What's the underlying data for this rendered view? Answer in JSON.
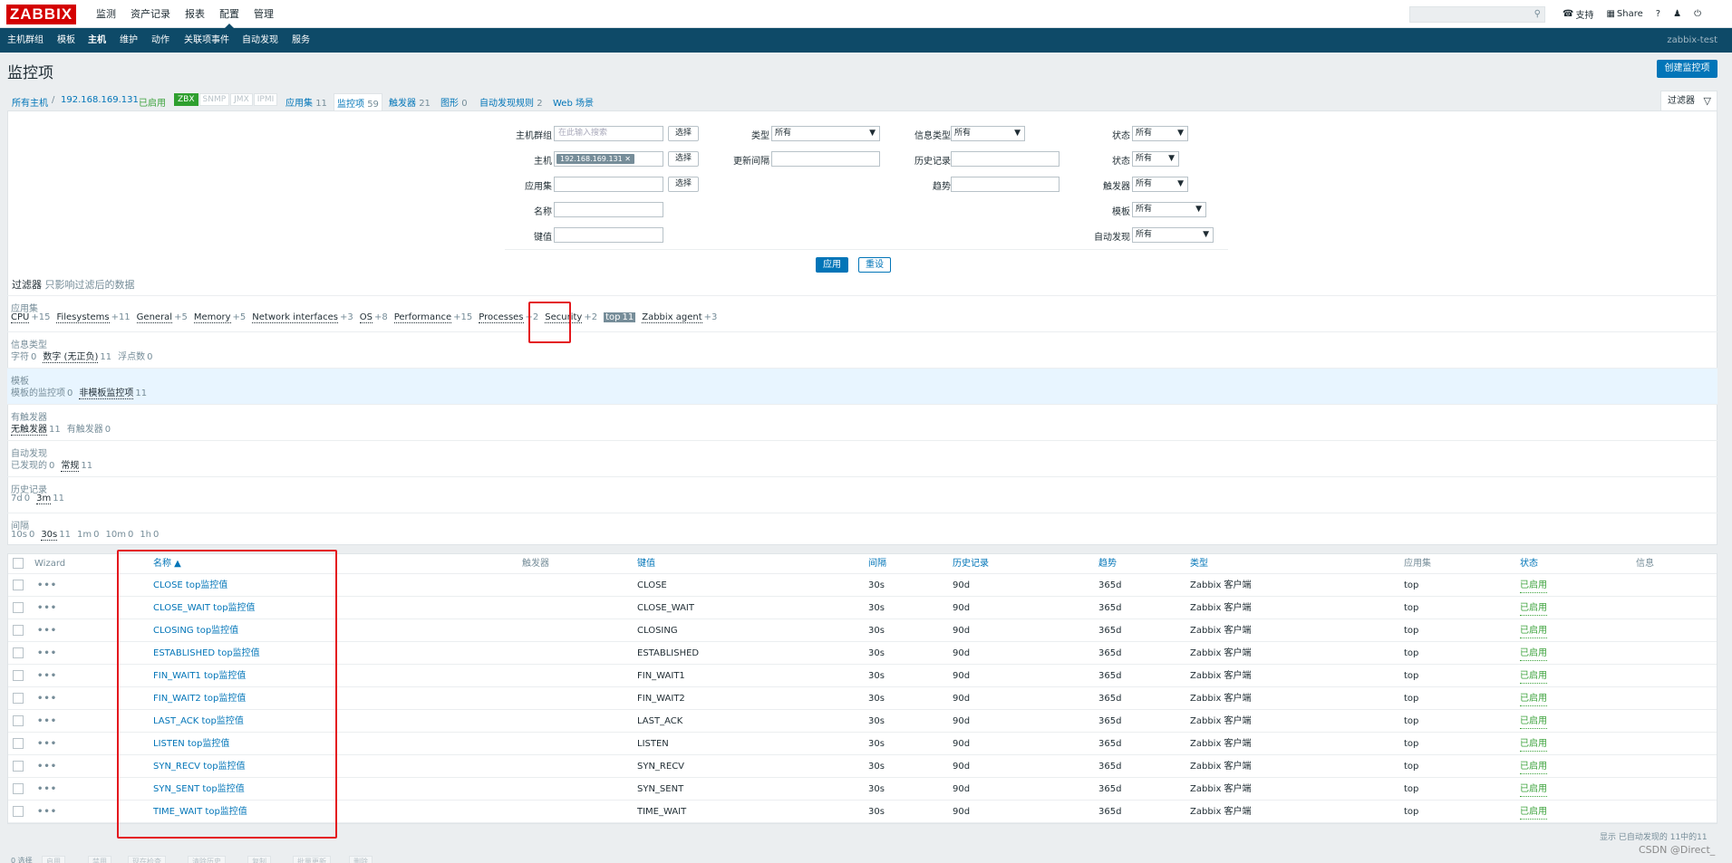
{
  "app": {
    "logo": "ZABBIX",
    "main_menu": [
      "监测",
      "资产记录",
      "报表",
      "配置",
      "管理"
    ],
    "main_menu_active": "配置",
    "top_right": {
      "support": "支持",
      "share": "Share",
      "help": "?",
      "user": "user-icon",
      "logout": "power-icon"
    },
    "search_placeholder": "",
    "sub_menu": [
      "主机群组",
      "模板",
      "主机",
      "维护",
      "动作",
      "关联项事件",
      "自动发现",
      "服务"
    ],
    "sub_menu_active": "主机",
    "server_name": "zabbix-test"
  },
  "page": {
    "title": "监控项",
    "create_button": "创建监控项",
    "filter_tab": "过滤器"
  },
  "host_nav": {
    "all_hosts": "所有主机",
    "sep": "/",
    "host": "192.168.169.131",
    "enabled": "已启用",
    "badges": [
      "ZBX",
      "SNMP",
      "JMX",
      "IPMI"
    ],
    "app": "应用集",
    "app_count": "11",
    "items": "监控项",
    "items_count": "59",
    "triggers": "触发器",
    "triggers_count": "21",
    "graphs": "图形",
    "graphs_count": "0",
    "discovery": "自动发现规则",
    "discovery_count": "2",
    "web": "Web 场景"
  },
  "filter": {
    "host_groups_label": "主机群组",
    "host_groups_placeholder": "在此输入搜索",
    "select": "选择",
    "host_label": "主机",
    "host_chip": "192.168.169.131",
    "app_label": "应用集",
    "name_label": "名称",
    "key_label": "键值",
    "type_label": "类型",
    "type_value": "所有",
    "interval_label": "更新间隔",
    "info_type_label": "信息类型",
    "info_type_value": "所有",
    "history_label": "历史记录",
    "trends_label": "趋势",
    "state_label": "状态",
    "state_value": "所有",
    "status_label": "状态",
    "status_value": "所有",
    "triggers_label": "触发器",
    "triggers_value": "所有",
    "template_label": "模板",
    "template_value": "所有",
    "discovery_label": "自动发现",
    "discovery_value": "所有",
    "apply": "应用",
    "reset": "重设",
    "subfilter_title": "过滤器",
    "subfilter_note": "只影响过滤后的数据"
  },
  "subfilters": [
    {
      "title": "应用集",
      "values": [
        {
          "name": "CPU",
          "count": "+15"
        },
        {
          "name": "Filesystems",
          "count": "+11"
        },
        {
          "name": "General",
          "count": "+5"
        },
        {
          "name": "Memory",
          "count": "+5"
        },
        {
          "name": "Network interfaces",
          "count": "+3"
        },
        {
          "name": "OS",
          "count": "+8"
        },
        {
          "name": "Performance",
          "count": "+15"
        },
        {
          "name": "Processes",
          "count": "+2"
        },
        {
          "name": "Security",
          "count": "+2"
        },
        {
          "name": "top",
          "count": "11",
          "selected": true
        },
        {
          "name": "Zabbix agent",
          "count": "+3"
        }
      ]
    },
    {
      "title": "信息类型",
      "values": [
        {
          "name": "字符",
          "count": "0",
          "plain": true
        },
        {
          "name": "数字 (无正负)",
          "count": "11"
        },
        {
          "name": "浮点数",
          "count": "0",
          "plain": true
        }
      ]
    },
    {
      "title": "模板",
      "highlight": true,
      "values": [
        {
          "name": "模板的监控项",
          "count": "0",
          "plain": true
        },
        {
          "name": "非模板监控项",
          "count": "11"
        }
      ]
    },
    {
      "title": "有触发器",
      "values": [
        {
          "name": "无触发器",
          "count": "11"
        },
        {
          "name": "有触发器",
          "count": "0",
          "plain": true
        }
      ]
    },
    {
      "title": "自动发现",
      "values": [
        {
          "name": "已发现的",
          "count": "0",
          "plain": true
        },
        {
          "name": "常规",
          "count": "11"
        }
      ]
    },
    {
      "title": "历史记录",
      "values": [
        {
          "name": "7d",
          "count": "0",
          "plain": true
        },
        {
          "name": "3m",
          "count": "11"
        }
      ]
    },
    {
      "title": "间隔",
      "values": [
        {
          "name": "10s",
          "count": "0",
          "plain": true
        },
        {
          "name": "30s",
          "count": "11"
        },
        {
          "name": "1m",
          "count": "0",
          "plain": true
        },
        {
          "name": "10m",
          "count": "0",
          "plain": true
        },
        {
          "name": "1h",
          "count": "0",
          "plain": true
        }
      ]
    }
  ],
  "table": {
    "headers": {
      "wizard": "Wizard",
      "name": "名称 ▲",
      "triggers": "触发器",
      "key": "键值",
      "interval": "间隔",
      "history": "历史记录",
      "trends": "趋势",
      "type": "类型",
      "app": "应用集",
      "status": "状态",
      "info": "信息"
    },
    "rows": [
      {
        "name": "CLOSE top监控值",
        "key": "CLOSE",
        "interval": "30s",
        "history": "90d",
        "trends": "365d",
        "type": "Zabbix 客户端",
        "app": "top",
        "status": "已启用"
      },
      {
        "name": "CLOSE_WAIT top监控值",
        "key": "CLOSE_WAIT",
        "interval": "30s",
        "history": "90d",
        "trends": "365d",
        "type": "Zabbix 客户端",
        "app": "top",
        "status": "已启用"
      },
      {
        "name": "CLOSING top监控值",
        "key": "CLOSING",
        "interval": "30s",
        "history": "90d",
        "trends": "365d",
        "type": "Zabbix 客户端",
        "app": "top",
        "status": "已启用"
      },
      {
        "name": "ESTABLISHED top监控值",
        "key": "ESTABLISHED",
        "interval": "30s",
        "history": "90d",
        "trends": "365d",
        "type": "Zabbix 客户端",
        "app": "top",
        "status": "已启用"
      },
      {
        "name": "FIN_WAIT1 top监控值",
        "key": "FIN_WAIT1",
        "interval": "30s",
        "history": "90d",
        "trends": "365d",
        "type": "Zabbix 客户端",
        "app": "top",
        "status": "已启用"
      },
      {
        "name": "FIN_WAIT2 top监控值",
        "key": "FIN_WAIT2",
        "interval": "30s",
        "history": "90d",
        "trends": "365d",
        "type": "Zabbix 客户端",
        "app": "top",
        "status": "已启用"
      },
      {
        "name": "LAST_ACK top监控值",
        "key": "LAST_ACK",
        "interval": "30s",
        "history": "90d",
        "trends": "365d",
        "type": "Zabbix 客户端",
        "app": "top",
        "status": "已启用"
      },
      {
        "name": "LISTEN top监控值",
        "key": "LISTEN",
        "interval": "30s",
        "history": "90d",
        "trends": "365d",
        "type": "Zabbix 客户端",
        "app": "top",
        "status": "已启用"
      },
      {
        "name": "SYN_RECV top监控值",
        "key": "SYN_RECV",
        "interval": "30s",
        "history": "90d",
        "trends": "365d",
        "type": "Zabbix 客户端",
        "app": "top",
        "status": "已启用"
      },
      {
        "name": "SYN_SENT top监控值",
        "key": "SYN_SENT",
        "interval": "30s",
        "history": "90d",
        "trends": "365d",
        "type": "Zabbix 客户端",
        "app": "top",
        "status": "已启用"
      },
      {
        "name": "TIME_WAIT top监控值",
        "key": "TIME_WAIT",
        "interval": "30s",
        "history": "90d",
        "trends": "365d",
        "type": "Zabbix 客户端",
        "app": "top",
        "status": "已启用"
      }
    ],
    "footer": "显示 已自动发现的 11中的11"
  },
  "action_bar": {
    "selected": "0 选择",
    "buttons": [
      "启用",
      "禁用",
      "现在检查",
      "清除历史",
      "复制",
      "批量更新",
      "删除"
    ]
  },
  "watermark": "CSDN @Direct_",
  "colors": {
    "brand": "#d40000",
    "nav": "#0e4a68",
    "link": "#0275b8",
    "enabled": "#3da33d",
    "highlight": "#e4181e"
  }
}
